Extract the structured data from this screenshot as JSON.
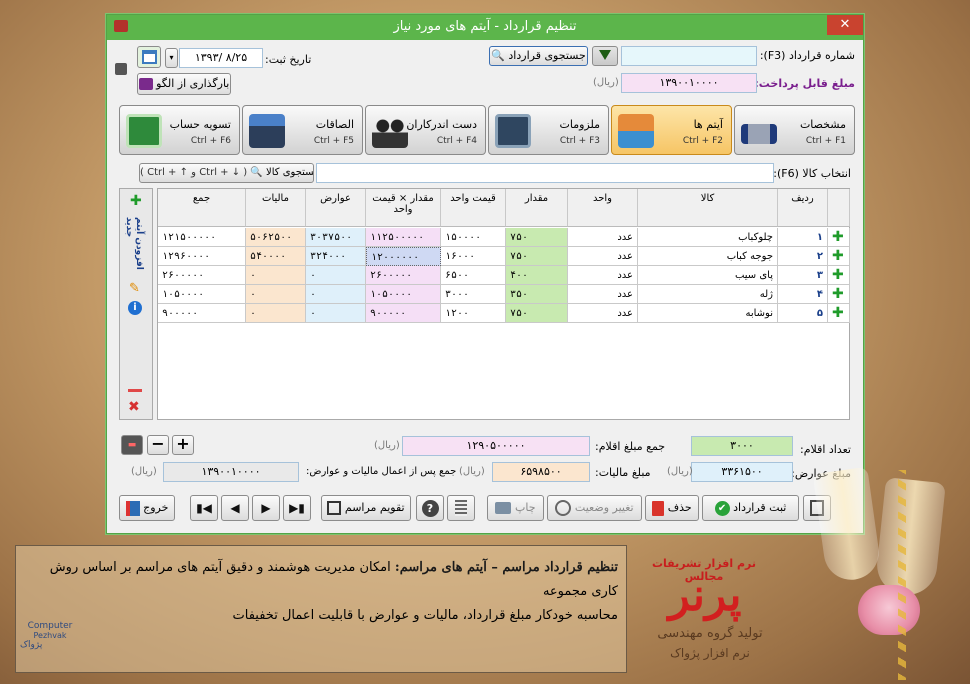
{
  "window": {
    "title": "تنظیم قرارداد - آیتم های مورد نیاز",
    "close": "✕"
  },
  "header": {
    "contract_no_label": "شماره قرارداد (F3):",
    "contract_no_value": "",
    "payable_label": "مبلغ قابل پرداخت:",
    "payable_value": "۱۳۹۰۰۱۰۰۰۰",
    "payable_unit": "(ریال)",
    "contract_search": "جستجوی قرارداد",
    "date_label": "تاریخ ثبت:",
    "date_value": "۱۳۹۳/ ۸/۲۵",
    "load_template": "بارگذاری از الگو"
  },
  "tabs": [
    {
      "label": "مشخصات",
      "shortcut": "Ctrl + F1"
    },
    {
      "label": "آیتم ها",
      "shortcut": "Ctrl + F2"
    },
    {
      "label": "ملزومات",
      "shortcut": "Ctrl + F3"
    },
    {
      "label": "دست اندرکاران",
      "shortcut": "Ctrl + F4"
    },
    {
      "label": "الصاقات",
      "shortcut": "Ctrl + F5"
    },
    {
      "label": "تسویه حساب",
      "shortcut": "Ctrl + F6"
    }
  ],
  "item_select": {
    "label": "انتخاب کالا (F6):",
    "value": "",
    "search": "جستجوی کالا",
    "hint": "( Ctrl + ↑ و Ctrl + ↓ )"
  },
  "side": {
    "add_new": "افزودن آیتم جدید"
  },
  "table": {
    "headers": [
      "ردیف",
      "کالا",
      "واحد",
      "مقدار",
      "قیمت واحد",
      "مقدار × قیمت واحد",
      "عوارض",
      "مالیات",
      "جمع"
    ],
    "rows": [
      {
        "n": "۱",
        "item": "چلوکباب",
        "unit": "عدد",
        "qty": "۷۵۰",
        "price": "۱۵۰۰۰۰",
        "sub": "۱۱۲۵۰۰۰۰۰",
        "duty": "۳۰۳۷۵۰۰",
        "tax": "۵۰۶۲۵۰۰",
        "total": "۱۲۱۵۰۰۰۰۰"
      },
      {
        "n": "۲",
        "item": "جوجه کباب",
        "unit": "عدد",
        "qty": "۷۵۰",
        "price": "۱۶۰۰۰",
        "sub": "۱۲۰۰۰۰۰۰",
        "duty": "۳۲۴۰۰۰",
        "tax": "۵۴۰۰۰۰",
        "total": "۱۲۹۶۰۰۰۰"
      },
      {
        "n": "۳",
        "item": "پای سیب",
        "unit": "عدد",
        "qty": "۴۰۰",
        "price": "۶۵۰۰",
        "sub": "۲۶۰۰۰۰۰",
        "duty": "۰",
        "tax": "۰",
        "total": "۲۶۰۰۰۰۰"
      },
      {
        "n": "۴",
        "item": "ژله",
        "unit": "عدد",
        "qty": "۳۵۰",
        "price": "۳۰۰۰",
        "sub": "۱۰۵۰۰۰۰",
        "duty": "۰",
        "tax": "۰",
        "total": "۱۰۵۰۰۰۰"
      },
      {
        "n": "۵",
        "item": "نوشابه",
        "unit": "عدد",
        "qty": "۷۵۰",
        "price": "۱۲۰۰",
        "sub": "۹۰۰۰۰۰",
        "duty": "۰",
        "tax": "۰",
        "total": "۹۰۰۰۰۰"
      }
    ]
  },
  "summary": {
    "count_label": "تعداد اقلام:",
    "count_value": "۳۰۰۰",
    "items_total_label": "جمع مبلغ اقلام:",
    "items_total_value": "۱۲۹۰۵۰۰۰۰۰",
    "rial": "(ریال)",
    "duty_label": "مبلغ عوارض:",
    "duty_value": "۳۳۶۱۵۰۰",
    "tax_label": "مبلغ مالیات:",
    "tax_value": "۶۵۹۸۵۰۰",
    "net_label": "جمع پس از اعمال مالیات و عوارض:",
    "net_value": "۱۳۹۰۰۱۰۰۰۰"
  },
  "buttons": {
    "save": "ثبت قرارداد",
    "delete": "حذف",
    "status": "تغییر وضعیت",
    "print": "چاپ",
    "calendar": "تقویم مراسم",
    "exit": "خروج"
  },
  "caption": {
    "title": "تنظیم قرارداد مراسم – آیتم های مراسم:",
    "line1": "امکان مدیریت هوشمند و دقیق آیتم های مراسم بر اساس روش کاری مجموعه",
    "line2": "محاسبه خودکار مبلغ قرارداد، مالیات و عوارض با قابلیت اعمال تخفیفات"
  },
  "brand": {
    "subtitle": "نرم افزار تشریفات مجالس",
    "name": "پرنر",
    "producer": "تولید گروه مهندسی",
    "company": "نرم افزار پژواک",
    "logo_line1": "Computer",
    "logo_line2": "Pezhvak",
    "logo_line3": "پژواک"
  },
  "colors": {
    "green": "#5cb54b",
    "qty_bg": "#c8eab0",
    "sub_bg": "#f5dff6",
    "duty_bg": "#dff0fa",
    "tax_bg": "#fbe6cf",
    "active_tab": "#f9cf7c"
  }
}
